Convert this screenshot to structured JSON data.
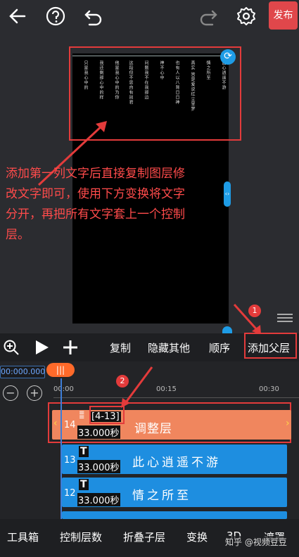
{
  "topbar": {
    "back_icon": "arrow-left-icon",
    "help_icon": "question-circle-icon",
    "undo_icon": "undo-icon",
    "redo_icon": "redo-icon",
    "settings_icon": "gear-icon",
    "publish_label": "发布"
  },
  "preview": {
    "columns": [
      "此心逍遥不游",
      "情之所至",
      "真实 皆是爱说红尘里梦",
      "也有人以八背日日神",
      "神不心中",
      "问题我不在我那边",
      "这段但不思自有别君",
      "他是我心中的为你",
      "我还剩那心中的样",
      "只是我心中的"
    ],
    "annotation": "添加第一列文字后直接复制图层修改文字即可，使用下方变换将文字分开，再把所有文字套上一个控制层。"
  },
  "toolbar": {
    "zoom_icon": "zoom-in-icon",
    "play_icon": "play-icon",
    "add_icon": "plus-icon",
    "copy_label": "复制",
    "hide_others_label": "隐藏其他",
    "order_label": "顺序",
    "add_parent_label": "添加父层",
    "badge_1": "1",
    "badge_2": "2"
  },
  "timeline": {
    "time_readout": "00:000.000",
    "playhead_label": "|||",
    "zoom_out": "−",
    "zoom_in": "+",
    "ticks": [
      "00:00",
      "00:15",
      "00:30"
    ],
    "tracks": [
      {
        "num": "14",
        "range": "[4-13]",
        "duration": "33.000秒",
        "title": "调整层",
        "color": "#f0865e"
      },
      {
        "num": "13",
        "icon": "T",
        "duration": "33.000秒",
        "title": "此心逍遥不游",
        "color": "#1e8ee0"
      },
      {
        "num": "12",
        "icon": "T",
        "duration": "33.000秒",
        "title": "情之所至",
        "color": "#1e8ee0"
      }
    ]
  },
  "bottombar": {
    "items": [
      "工具箱",
      "控制层数",
      "折叠子层",
      "变换",
      "3D",
      "遮罩"
    ],
    "watermark": "知乎 @视频豆豆"
  }
}
